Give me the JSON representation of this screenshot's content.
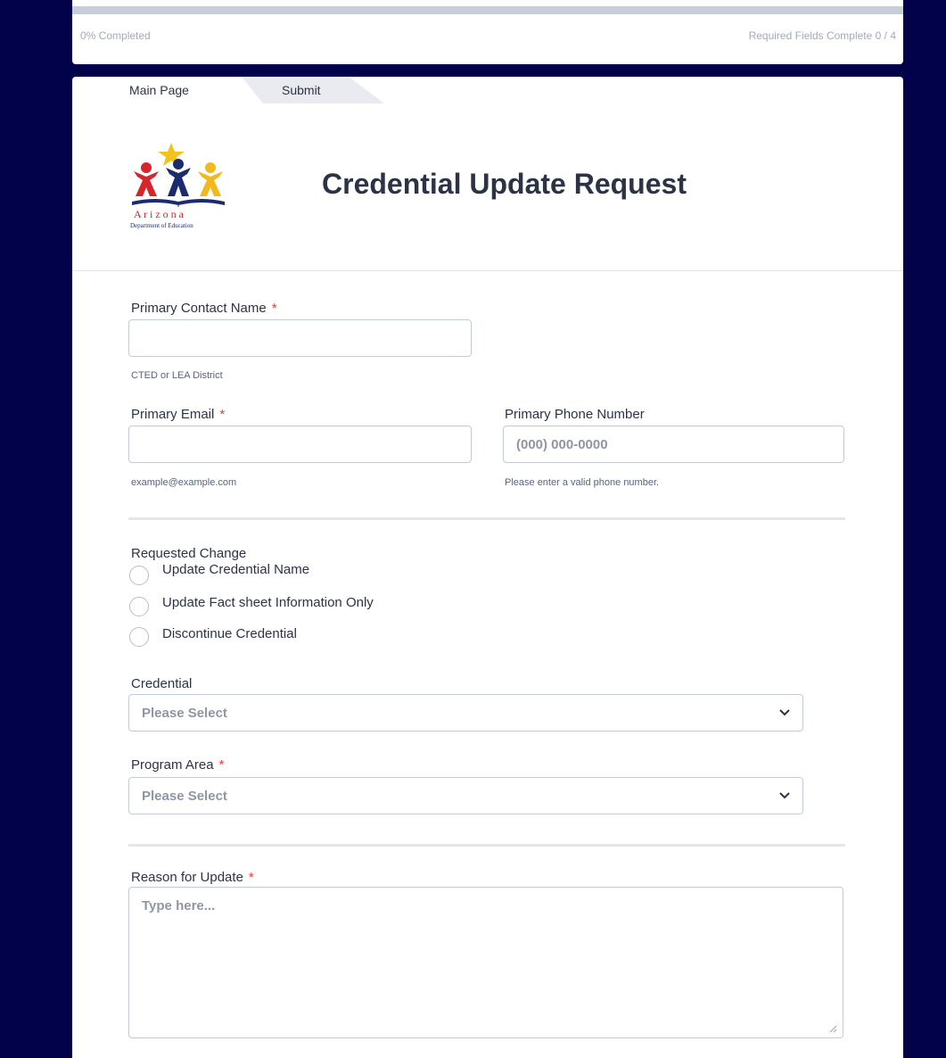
{
  "progress": {
    "completed_text": "0% Completed",
    "completed_fraction": 0,
    "required_text": "Required Fields Complete 0 / 4"
  },
  "tabs": [
    {
      "label": "Main Page"
    },
    {
      "label": "Submit"
    }
  ],
  "header": {
    "logo_text_line1": "A r i z o n a",
    "logo_text_line2": "Department of Education",
    "title": "Credential Update Request"
  },
  "fields": {
    "primary_contact": {
      "label": "Primary Contact Name",
      "required_mark": "*",
      "value": "",
      "sublabel": "CTED or LEA District"
    },
    "primary_email": {
      "label": "Primary Email",
      "required_mark": "*",
      "value": "",
      "sublabel": "example@example.com"
    },
    "primary_phone": {
      "label": "Primary Phone Number",
      "placeholder": "(000) 000-0000",
      "sublabel": "Please enter a valid phone number."
    },
    "requested_change": {
      "label": "Requested Change",
      "options": [
        "Update Credential Name",
        "Update Fact sheet Information Only",
        "Discontinue Credential"
      ]
    },
    "credential": {
      "label": "Credential",
      "selected": "Please Select"
    },
    "program_area": {
      "label": "Program Area",
      "required_mark": "*",
      "selected": "Please Select"
    },
    "reason": {
      "label": "Reason for Update",
      "required_mark": "*",
      "placeholder": "Type here..."
    }
  },
  "colors": {
    "page_background": "#01024a",
    "required_asterisk": "#f23a3c",
    "text": "#2c3345"
  }
}
